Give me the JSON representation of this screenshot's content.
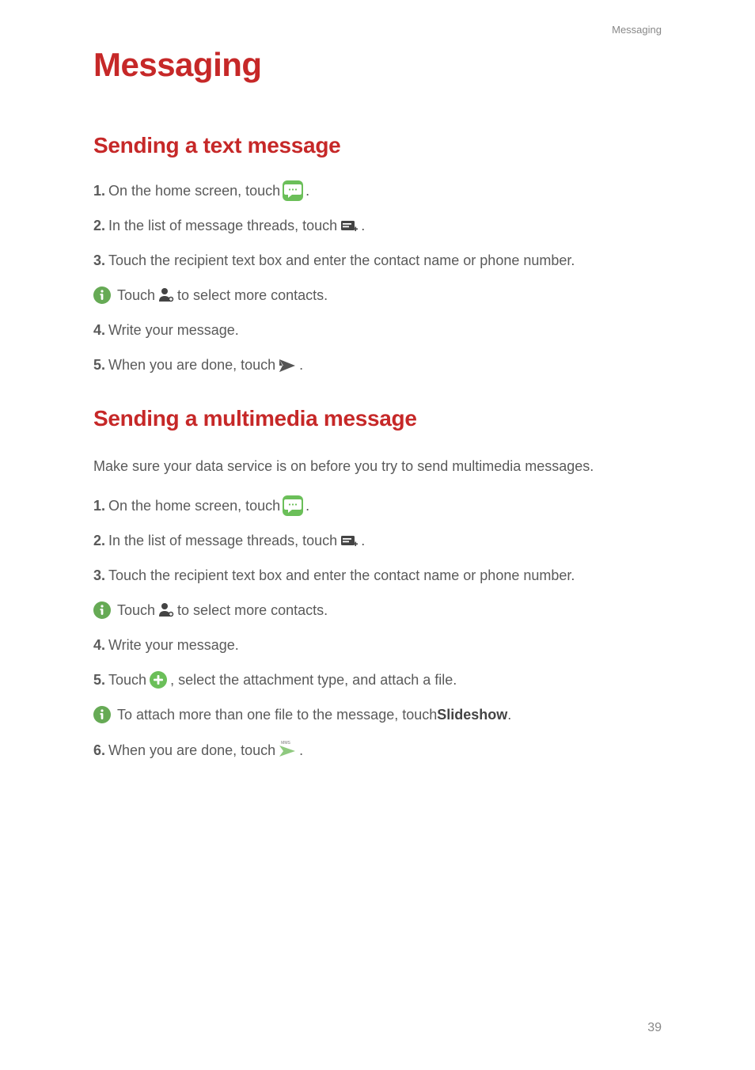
{
  "breadcrumb": "Messaging",
  "chapter_title": "Messaging",
  "section1": {
    "title": "Sending a text message",
    "steps": {
      "s1_pre": "On the home screen, touch ",
      "s1_post": " .",
      "s2_pre": "In the list of message threads, touch ",
      "s2_post": ".",
      "s3": "Touch the recipient text box and enter the contact name or phone number.",
      "tip_pre": "Touch ",
      "tip_post": "to select more contacts.",
      "s4": "Write your message.",
      "s5_pre": "When you are done, touch ",
      "s5_post": "."
    }
  },
  "section2": {
    "title": "Sending a multimedia message",
    "intro": "Make sure your data service is on before you try to send multimedia messages.",
    "steps": {
      "s1_pre": "On the home screen, touch ",
      "s1_post": " .",
      "s2_pre": "In the list of message threads, touch ",
      "s2_post": ".",
      "s3": "Touch the recipient text box and enter the contact name or phone number.",
      "tip1_pre": "Touch ",
      "tip1_post": "to select more contacts.",
      "s4": "Write your message.",
      "s5_pre": "Touch ",
      "s5_post": " , select the attachment type, and attach a file.",
      "tip2_pre": "To attach more than one file to the message, touch ",
      "tip2_bold": "Slideshow",
      "tip2_post": ".",
      "s6_pre": "When you are done, touch ",
      "s6_post": " ."
    }
  },
  "page_number": "39",
  "step_numbers": {
    "n1": "1.",
    "n2": "2.",
    "n3": "3.",
    "n4": "4.",
    "n5": "5.",
    "n6": "6."
  }
}
